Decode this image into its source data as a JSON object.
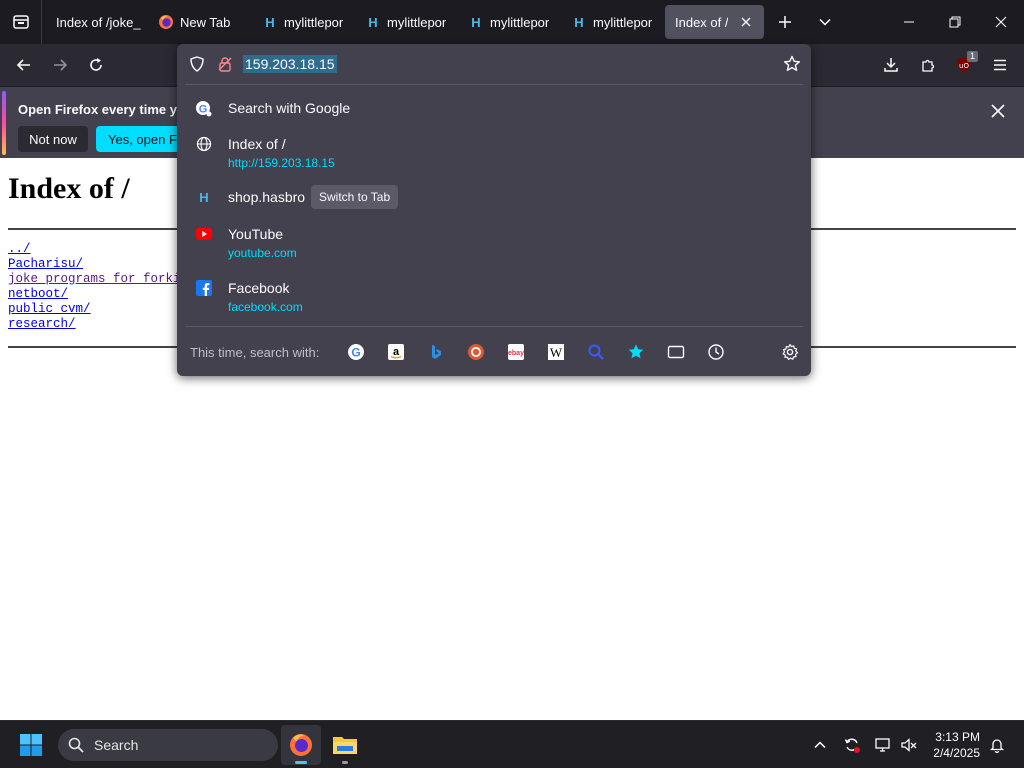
{
  "tabs": [
    {
      "title": "Index of /joke_",
      "favicon": "blank"
    },
    {
      "title": "New Tab",
      "favicon": "firefox-icon"
    },
    {
      "title": "mylittlepor",
      "favicon": "hasbro-icon"
    },
    {
      "title": "mylittlepor",
      "favicon": "hasbro-icon"
    },
    {
      "title": "mylittlepor",
      "favicon": "hasbro-icon"
    },
    {
      "title": "mylittlepor",
      "favicon": "hasbro-icon"
    },
    {
      "title": "Index of /",
      "favicon": "blank",
      "active": true
    }
  ],
  "toolbar": {
    "extension_badge": "1"
  },
  "notification": {
    "message": "Open Firefox every time you",
    "not_now": "Not now",
    "yes_open": "Yes, open Fire"
  },
  "page": {
    "heading": "Index of /",
    "links": [
      "../",
      "Pacharisu/",
      "joke_programs_for_forkie",
      "netboot/",
      "public_cvm/",
      "research/"
    ]
  },
  "url_dropdown": {
    "url": "159.203.18.15",
    "search_row": {
      "title": "Search with Google",
      "icon": "google-search-icon"
    },
    "results": [
      {
        "title": "Index of /",
        "subtitle": "http://159.203.18.15",
        "icon": "globe-icon"
      },
      {
        "title": "shop.hasbro",
        "subtitle": "",
        "icon": "hasbro-icon",
        "action": "Switch to Tab"
      },
      {
        "title": "YouTube",
        "subtitle": "youtube.com",
        "icon": "youtube-icon"
      },
      {
        "title": "Facebook",
        "subtitle": "facebook.com",
        "icon": "facebook-icon"
      }
    ],
    "search_with_label": "This time, search with:",
    "engines": [
      "google-icon",
      "amazon-icon",
      "bing-icon",
      "duckduckgo-icon",
      "ebay-icon",
      "wikipedia-icon",
      "search-tabs-icon",
      "bookmarks-star-icon",
      "tabs-icon",
      "history-icon"
    ]
  },
  "taskbar": {
    "search_label": "Search",
    "time": "3:13 PM",
    "date": "2/4/2025"
  },
  "colors": {
    "accent_cyan": "#00ddff",
    "toolbar_bg": "#2b2a33",
    "panel_bg": "#42414d",
    "link_blue": "#0000ee"
  }
}
